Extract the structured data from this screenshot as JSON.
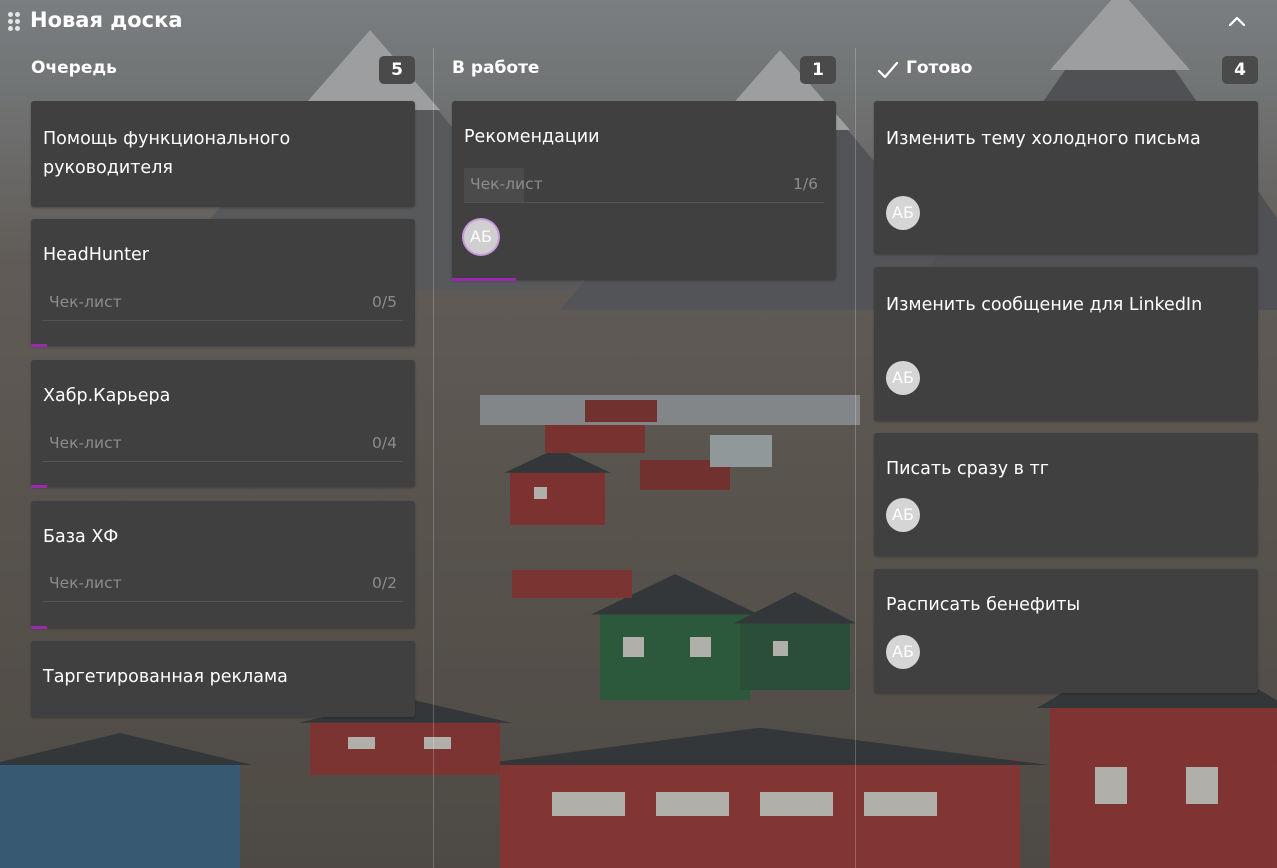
{
  "board": {
    "title": "Новая доска"
  },
  "colors": {
    "card_bg": "#404040",
    "badge_bg": "#4a4a4a",
    "progress_accent": "#9c27b0",
    "muted_text": "#8c8c8c"
  },
  "columns": [
    {
      "title": "Очередь",
      "count": "5",
      "cards": [
        {
          "title": "Помощь функционального руководителя"
        },
        {
          "title": "HeadHunter",
          "checklist": {
            "label": "Чек-лист",
            "count": "0/5",
            "progress": 0
          }
        },
        {
          "title": "Хабр.Карьера",
          "checklist": {
            "label": "Чек-лист",
            "count": "0/4",
            "progress": 0
          }
        },
        {
          "title": "База ХФ",
          "checklist": {
            "label": "Чек-лист",
            "count": "0/2",
            "progress": 0
          }
        },
        {
          "title": "Таргетированная реклама"
        }
      ]
    },
    {
      "title": "В работе",
      "count": "1",
      "cards": [
        {
          "title": "Рекомендации",
          "checklist": {
            "label": "Чек-лист",
            "count": "1/6",
            "progress": 0.1667
          },
          "avatar": "АБ"
        }
      ]
    },
    {
      "title": "Готово",
      "icon": "check-icon",
      "count": "4",
      "cards": [
        {
          "title": "Изменить тему холодного письма",
          "avatar": "АБ"
        },
        {
          "title": "Изменить сообщение для LinkedIn",
          "avatar": "АБ"
        },
        {
          "title": "Писать сразу в тг",
          "avatar": "АБ"
        },
        {
          "title": "Расписать бенефиты",
          "avatar": "АБ"
        }
      ]
    }
  ],
  "icons": {
    "drag_handle": "drag-handle-icon",
    "collapse": "chevron-up-icon",
    "done": "check-icon"
  }
}
